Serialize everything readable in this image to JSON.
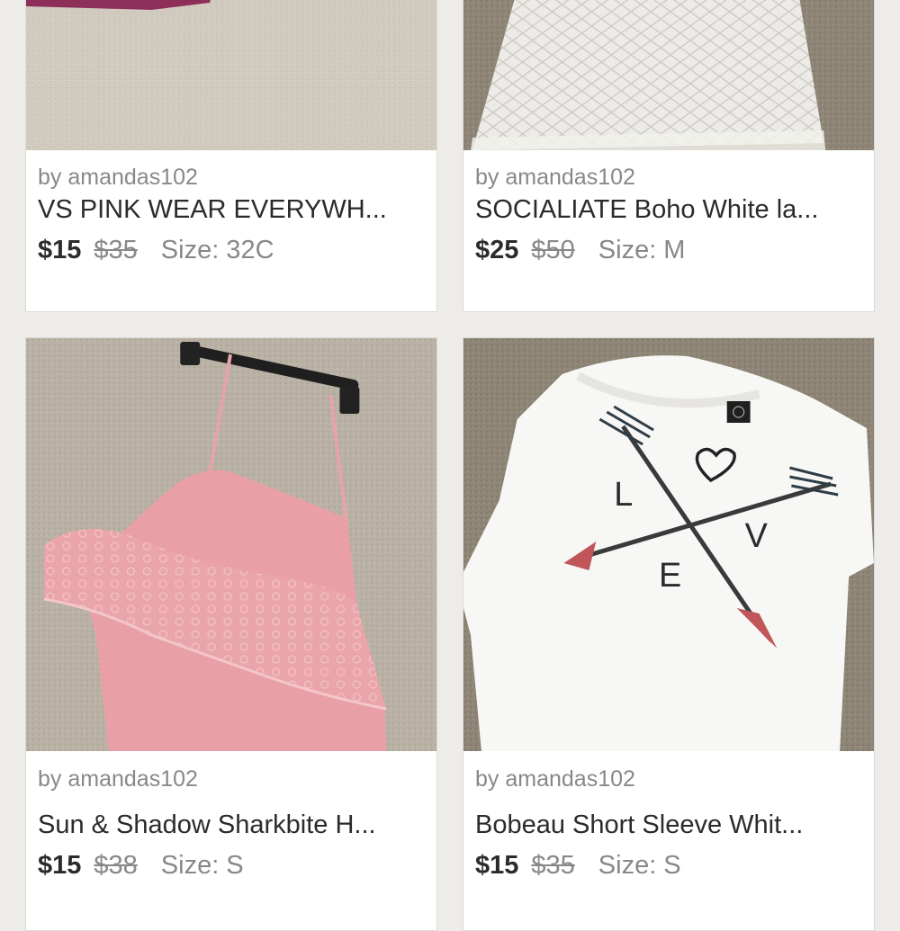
{
  "listings": [
    {
      "seller": "by amandas102",
      "title": "VS PINK WEAR EVERYWH...",
      "price": "$15",
      "original_price": "$35",
      "size": "Size: 32C"
    },
    {
      "seller": "by amandas102",
      "title": "SOCIALIATE Boho White la...",
      "price": "$25",
      "original_price": "$50",
      "size": "Size: M"
    },
    {
      "seller": "by amandas102",
      "title": "Sun & Shadow Sharkbite H...",
      "price": "$15",
      "original_price": "$38",
      "size": "Size: S"
    },
    {
      "seller": "by amandas102",
      "title": "Bobeau Short Sleeve Whit...",
      "price": "$15",
      "original_price": "$35",
      "size": "Size: S"
    }
  ],
  "shirt_print": {
    "l": "L",
    "v": "V",
    "e": "E"
  },
  "colors": {
    "page_bg": "#eeece9",
    "card_bg": "#ffffff",
    "text_dark": "#2b2b2b",
    "text_muted": "#8a8886"
  }
}
